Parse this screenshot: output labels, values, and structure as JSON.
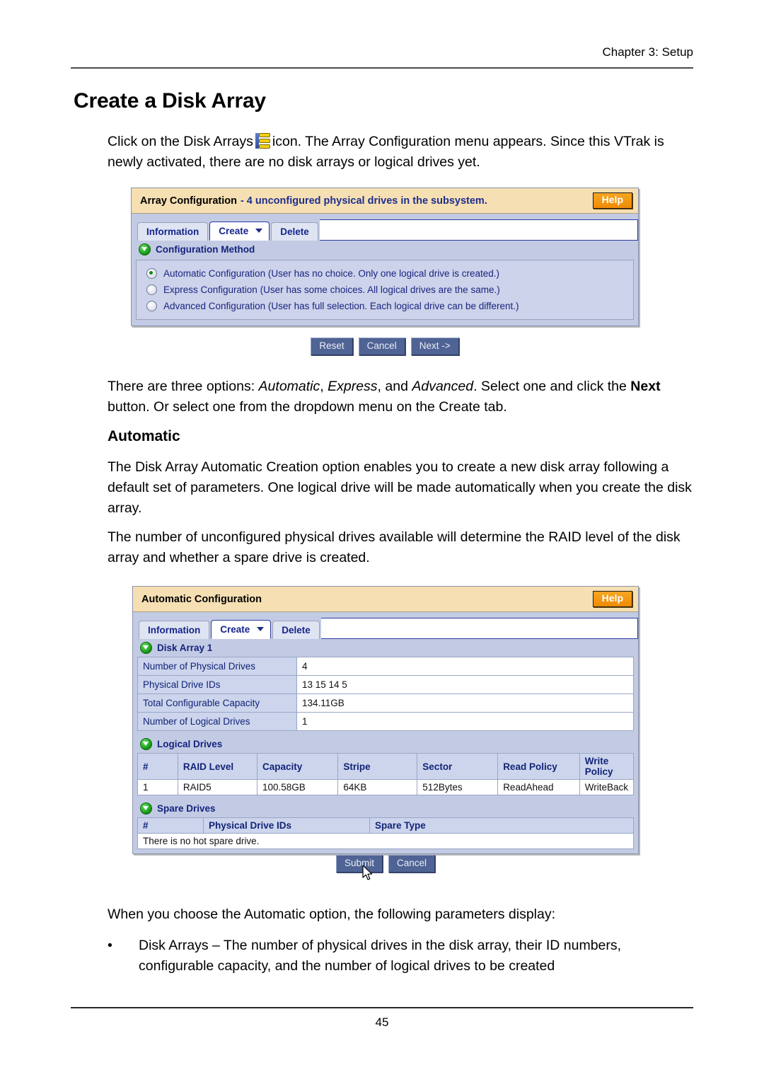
{
  "page": {
    "running_header": "Chapter 3: Setup",
    "title": "Create a Disk Array",
    "number": "45"
  },
  "intro": {
    "before_icon": "Click on the Disk Arrays",
    "icon_name": "disk-arrays-icon",
    "after_icon": "icon. The Array Configuration menu appears. Since this VTrak is newly activated, there are no disk arrays or logical drives yet."
  },
  "array_config_panel": {
    "title": "Array Configuration",
    "subtitle": "- 4 unconfigured physical drives in the subsystem.",
    "help_label": "Help",
    "tabs": [
      {
        "label": "Information",
        "active": false,
        "caret": false
      },
      {
        "label": "Create",
        "active": true,
        "caret": true
      },
      {
        "label": "Delete",
        "active": false,
        "caret": false
      }
    ],
    "section_label": "Configuration Method",
    "options": [
      {
        "label": "Automatic Configuration (User has no choice. Only one logical drive is created.)",
        "selected": true
      },
      {
        "label": "Express Configuration (User has some choices. All logical drives are the same.)",
        "selected": false
      },
      {
        "label": "Advanced Configuration (User has full selection. Each logical drive can be different.)",
        "selected": false
      }
    ],
    "buttons": [
      "Reset",
      "Cancel",
      "Next ->"
    ]
  },
  "paragraph_options": {
    "l1_a": "There are three options: ",
    "l1_i1": "Automatic",
    "l1_b": ", ",
    "l1_i2": "Express",
    "l1_c": ", and ",
    "l1_i3": "Advanced",
    "l1_d": ". Select one and click the ",
    "l1_bold": "Next",
    "l1_e": " button. Or select one from the dropdown menu on the Create tab."
  },
  "automatic_section": {
    "heading": "Automatic",
    "para1": "The Disk Array Automatic Creation option enables you to create a new disk array following a default set of parameters. One logical drive will be made automatically when you create the disk array.",
    "para2": "The number of unconfigured physical drives available will determine the RAID level of the disk array and whether a spare drive is created."
  },
  "automatic_config_panel": {
    "title": "Automatic Configuration",
    "help_label": "Help",
    "tabs": [
      {
        "label": "Information",
        "active": false,
        "caret": false
      },
      {
        "label": "Create",
        "active": true,
        "caret": true
      },
      {
        "label": "Delete",
        "active": false,
        "caret": false
      }
    ],
    "disk_array_section": "Disk Array 1",
    "disk_array_rows": [
      {
        "label": "Number of Physical Drives",
        "value": "4"
      },
      {
        "label": "Physical Drive IDs",
        "value": "13 15 14 5"
      },
      {
        "label": "Total Configurable Capacity",
        "value": "134.11GB"
      },
      {
        "label": "Number of Logical Drives",
        "value": "1"
      }
    ],
    "logical_drives_section": "Logical Drives",
    "logical_drives_headers": [
      "#",
      "RAID Level",
      "Capacity",
      "Stripe",
      "Sector",
      "Read Policy",
      "Write Policy"
    ],
    "logical_drives_rows": [
      [
        "1",
        "RAID5",
        "100.58GB",
        "64KB",
        "512Bytes",
        "ReadAhead",
        "WriteBack"
      ]
    ],
    "spare_drives_section": "Spare Drives",
    "spare_drives_headers": [
      "#",
      "Physical Drive IDs",
      "Spare Type"
    ],
    "spare_drives_empty_message": "There is no hot spare drive.",
    "buttons": [
      "Submit",
      "Cancel"
    ]
  },
  "closing": {
    "lead": "When you choose the Automatic option, the following parameters display:",
    "bullet_dot": "•",
    "bullet_text": "Disk Arrays – The number of physical drives in the disk array, their ID numbers, configurable capacity, and the number of logical drives to be created"
  },
  "colors": {
    "titlebar": "#f6dfb2",
    "panel": "#c3cbe4",
    "help_button": "#ef8a05",
    "link_blue": "#1d2f8f",
    "button_blue": "#4f6394",
    "green_icon": "#119411"
  }
}
